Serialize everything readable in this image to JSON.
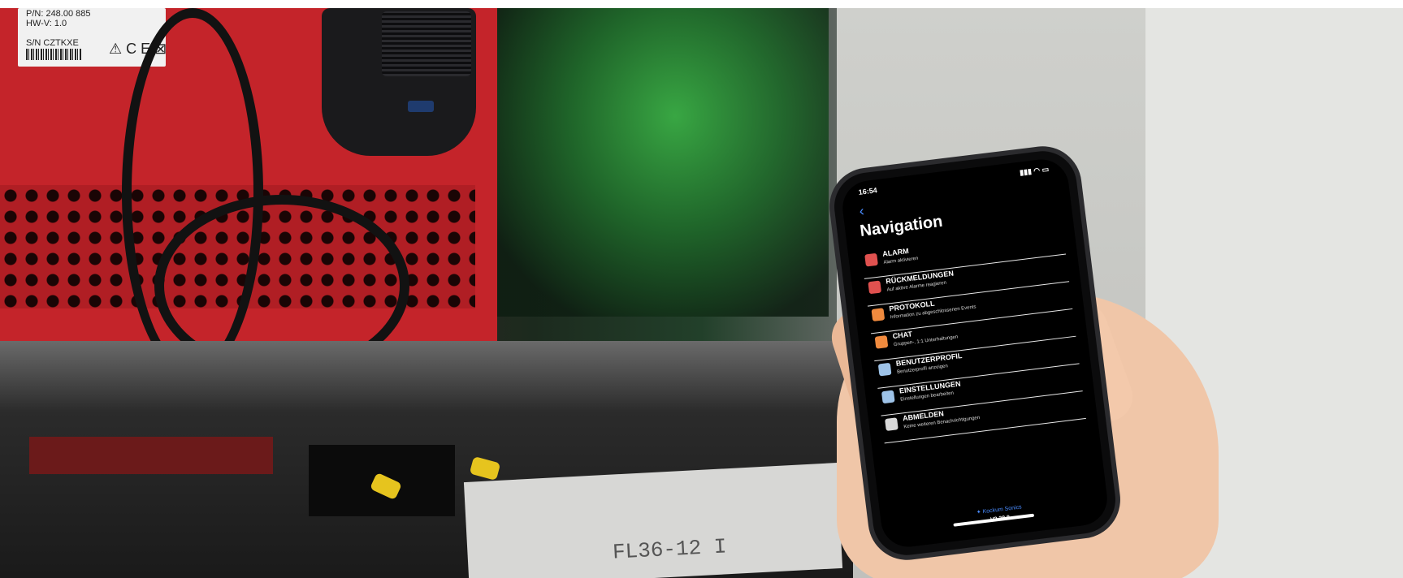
{
  "sticker": {
    "pn": "P/N:  248.00 885",
    "hwv": "HW-V:  1.0",
    "sn": "S/N  CZTKXE",
    "marks": "⚠ C E ⊠"
  },
  "paper_label": "FL36-12 I",
  "phone": {
    "time": "16:54",
    "back_glyph": "‹",
    "title": "Navigation",
    "items": [
      {
        "label": "ALARM",
        "sub": "Alarm aktivieren",
        "icon_color": "#e0514f"
      },
      {
        "label": "RÜCKMELDUNGEN",
        "sub": "Auf aktive Alarme reagieren",
        "icon_color": "#e0514f"
      },
      {
        "label": "PROTOKOLL",
        "sub": "Information zu abgeschlossenen Events",
        "icon_color": "#f08a3e"
      },
      {
        "label": "CHAT",
        "sub": "Gruppen-, 1:1 Unterhaltungen",
        "icon_color": "#f08a3e"
      },
      {
        "label": "BENUTZERPROFIL",
        "sub": "Benutzerprofil anzeigen",
        "icon_color": "#9ec3e8"
      },
      {
        "label": "EINSTELLUNGEN",
        "sub": "Einstellungen bearbeiten",
        "icon_color": "#9ec3e8"
      },
      {
        "label": "ABMELDEN",
        "sub": "Keine weiteren Benachrichtigungen",
        "icon_color": "#d9d9d9"
      }
    ],
    "brand": "✦ Kockum Sonics",
    "version": "V2.38.8"
  }
}
